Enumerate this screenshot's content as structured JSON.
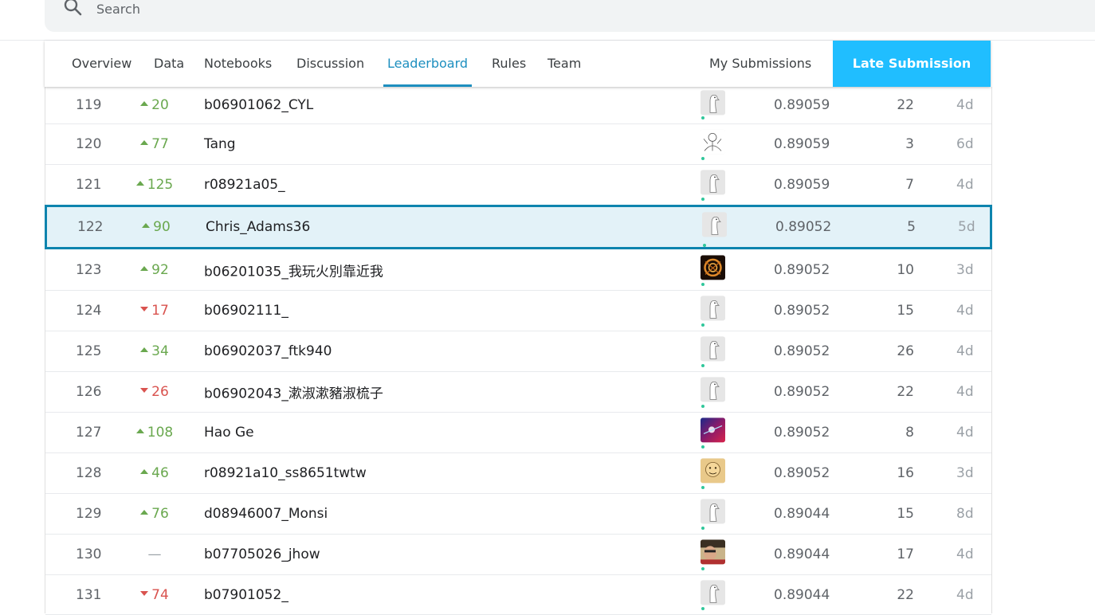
{
  "search": {
    "placeholder": "Search"
  },
  "tabs": {
    "overview": "Overview",
    "data": "Data",
    "notebooks": "Notebooks",
    "discussion": "Discussion",
    "leaderboard": "Leaderboard",
    "rules": "Rules",
    "team": "Team",
    "my_submissions": "My Submissions",
    "late_submission": "Late Submission",
    "active": "leaderboard"
  },
  "colors": {
    "accent": "#1d8fbf",
    "late_button": "#20beff",
    "up": "#6aa84f",
    "down": "#d9534f",
    "highlight_bg": "#e3f2f8",
    "highlight_border": "#0d84ae"
  },
  "rows": [
    {
      "rank": "119",
      "dir": "up",
      "change": "20",
      "team": "b06901062_CYL",
      "avatar": "goose-avatar-icon",
      "score": "0.89059",
      "entries": "22",
      "last": "4d"
    },
    {
      "rank": "120",
      "dir": "up",
      "change": "77",
      "team": "Tang",
      "avatar": "sketch-avatar-icon",
      "score": "0.89059",
      "entries": "3",
      "last": "6d"
    },
    {
      "rank": "121",
      "dir": "up",
      "change": "125",
      "team": "r08921a05_",
      "avatar": "goose-avatar-icon",
      "score": "0.89059",
      "entries": "7",
      "last": "4d"
    },
    {
      "rank": "122",
      "dir": "up",
      "change": "90",
      "team": "Chris_Adams36",
      "avatar": "goose-avatar-icon",
      "score": "0.89052",
      "entries": "5",
      "last": "5d",
      "highlight": true
    },
    {
      "rank": "123",
      "dir": "up",
      "change": "92",
      "team": "b06201035_我玩火別靠近我",
      "avatar": "fire-ring-avatar-icon",
      "score": "0.89052",
      "entries": "10",
      "last": "3d"
    },
    {
      "rank": "124",
      "dir": "down",
      "change": "17",
      "team": "b06902111_",
      "avatar": "goose-avatar-icon",
      "score": "0.89052",
      "entries": "15",
      "last": "4d"
    },
    {
      "rank": "125",
      "dir": "up",
      "change": "34",
      "team": "b06902037_ftk940",
      "avatar": "goose-avatar-icon",
      "score": "0.89052",
      "entries": "26",
      "last": "4d"
    },
    {
      "rank": "126",
      "dir": "down",
      "change": "26",
      "team": "b06902043_漱淑漱豬淑梳子",
      "avatar": "goose-avatar-icon",
      "score": "0.89052",
      "entries": "22",
      "last": "4d"
    },
    {
      "rank": "127",
      "dir": "up",
      "change": "108",
      "team": "Hao Ge",
      "avatar": "galaxy-avatar-icon",
      "score": "0.89052",
      "entries": "8",
      "last": "4d"
    },
    {
      "rank": "128",
      "dir": "up",
      "change": "46",
      "team": "r08921a10_ss8651twtw",
      "avatar": "cartoon-avatar-icon",
      "score": "0.89052",
      "entries": "16",
      "last": "3d"
    },
    {
      "rank": "129",
      "dir": "up",
      "change": "76",
      "team": "d08946007_Monsi",
      "avatar": "goose-avatar-icon",
      "score": "0.89044",
      "entries": "15",
      "last": "8d"
    },
    {
      "rank": "130",
      "dir": "same",
      "change": "—",
      "team": "b07705026_jhow",
      "avatar": "photo-avatar-icon",
      "score": "0.89044",
      "entries": "17",
      "last": "4d"
    },
    {
      "rank": "131",
      "dir": "down",
      "change": "74",
      "team": "b07901052_",
      "avatar": "goose-avatar-icon",
      "score": "0.89044",
      "entries": "22",
      "last": "4d"
    }
  ]
}
